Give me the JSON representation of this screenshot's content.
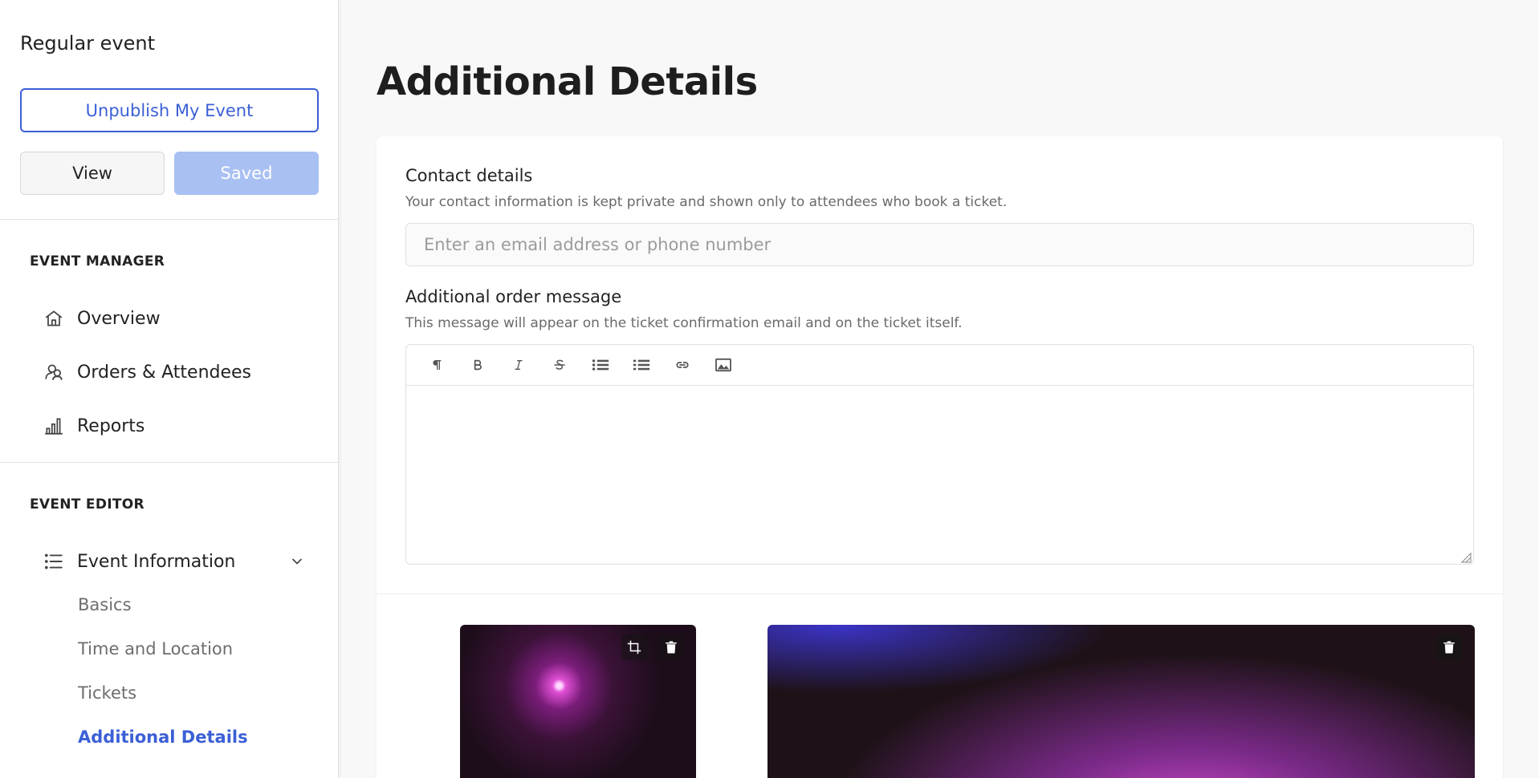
{
  "sidebar": {
    "event_type": "Regular event",
    "unpublish_label": "Unpublish My Event",
    "view_label": "View",
    "saved_label": "Saved",
    "event_manager": {
      "title": "EVENT MANAGER",
      "items": [
        {
          "label": "Overview",
          "icon": "home-icon"
        },
        {
          "label": "Orders & Attendees",
          "icon": "attendees-icon"
        },
        {
          "label": "Reports",
          "icon": "bar-chart-icon"
        }
      ]
    },
    "event_editor": {
      "title": "EVENT EDITOR",
      "event_information": {
        "label": "Event Information",
        "icon": "list-icon",
        "expanded": true
      },
      "sub_items": [
        "Basics",
        "Time and Location",
        "Tickets",
        "Additional Details"
      ],
      "active_sub_item": "Additional Details"
    }
  },
  "main": {
    "title": "Additional Details",
    "contact": {
      "label": "Contact details",
      "help": "Your contact information is kept private and shown only to attendees who book a ticket.",
      "value": "",
      "placeholder": "Enter an email address or phone number"
    },
    "order_message": {
      "label": "Additional order message",
      "help": "This message will appear on the ticket confirmation email and on the ticket itself.",
      "toolbar": [
        "paragraph-icon",
        "bold-icon",
        "italic-icon",
        "strikethrough-icon",
        "bullet-list-icon",
        "numbered-list-icon",
        "link-icon",
        "image-icon"
      ],
      "value": ""
    },
    "images": [
      {
        "name": "concert-image-small",
        "actions": [
          "crop-icon",
          "trash-icon"
        ]
      },
      {
        "name": "concert-image-large",
        "actions": [
          "trash-icon"
        ]
      }
    ]
  },
  "colors": {
    "accent": "#3b5fd6",
    "saved_button": "#a9c0f3",
    "background": "#f8f8f8"
  }
}
